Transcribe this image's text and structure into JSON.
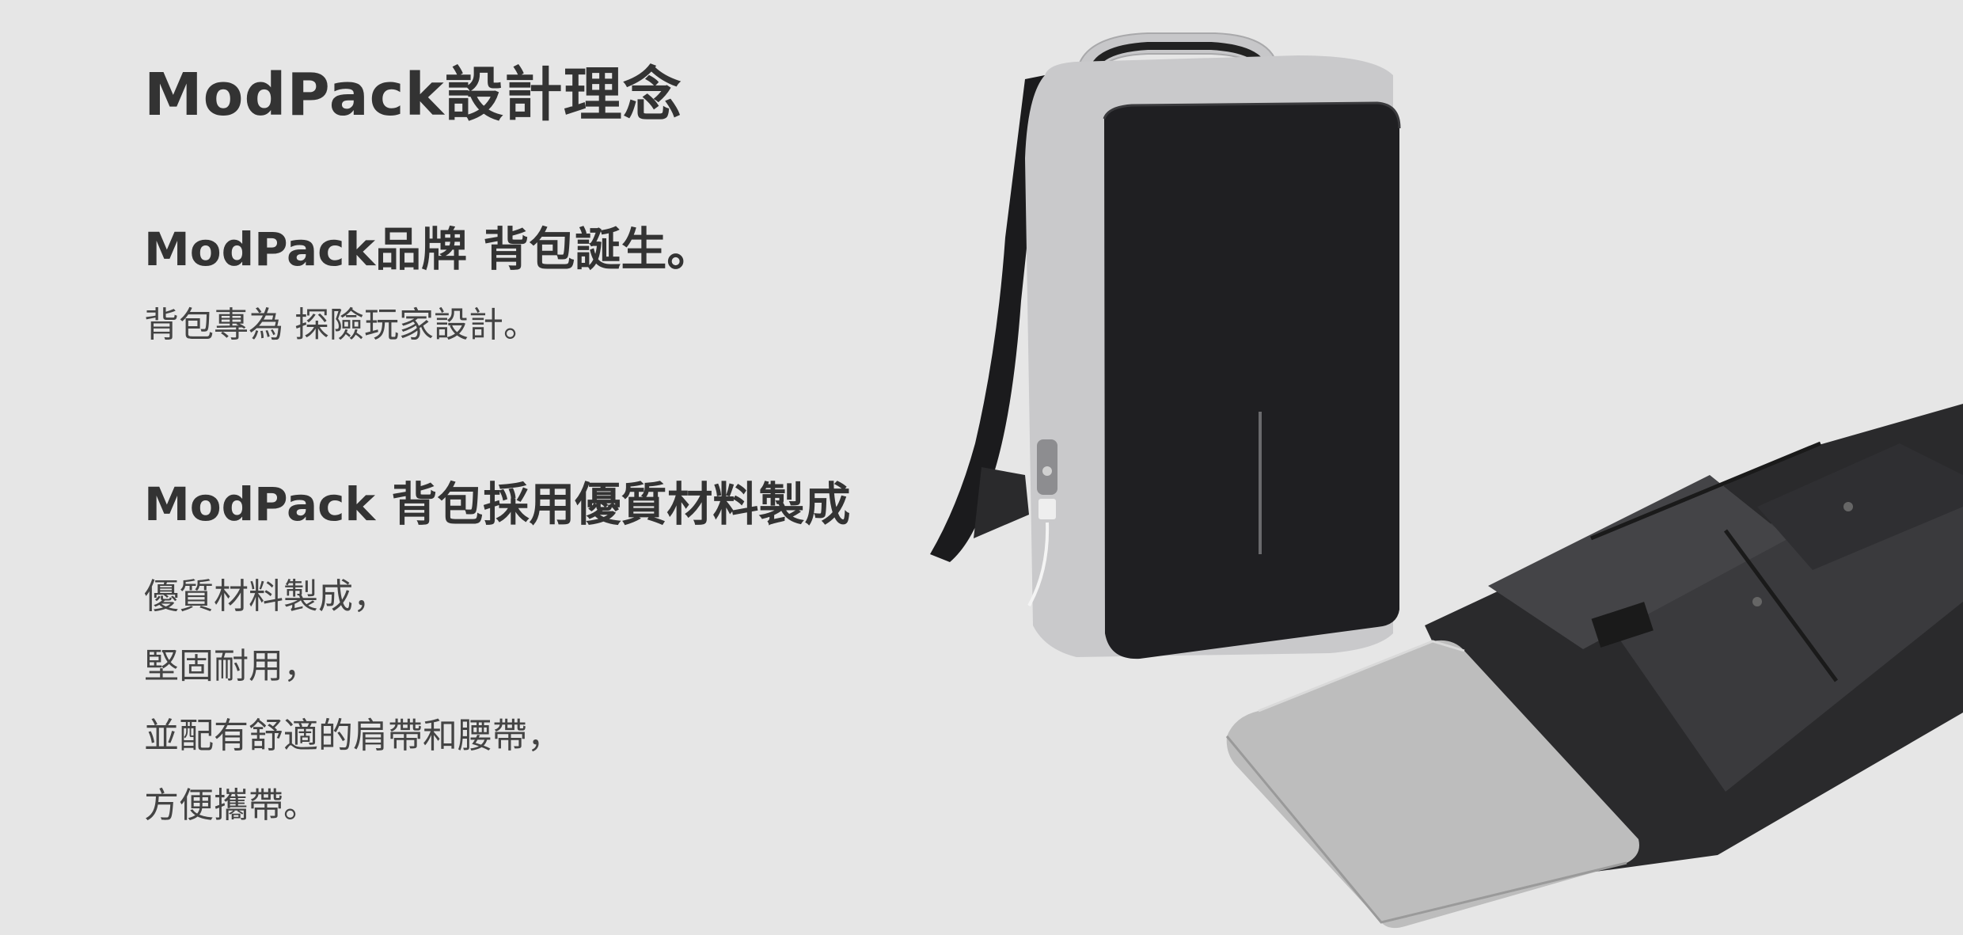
{
  "page": {
    "title": "ModPack設計理念"
  },
  "intro": {
    "heading": "ModPack品牌 背包誕生。",
    "text": "背包專為 探險玩家設計。"
  },
  "materials": {
    "heading": "ModPack 背包採用優質材料製成",
    "lines": [
      "優質材料製成，",
      "堅固耐用，",
      "並配有舒適的肩帶和腰帶，",
      "方便攜帶。"
    ]
  },
  "colors": {
    "background": "#e6e6e6",
    "text": "#333333",
    "bag_front": "#1f1f22",
    "bag_side": "#c9c9cb",
    "laptop": "#bdbdbd"
  }
}
